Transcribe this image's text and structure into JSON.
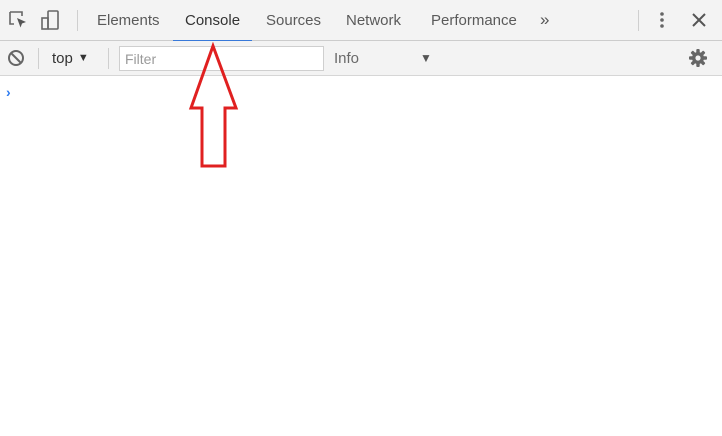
{
  "tabs": [
    {
      "label": "Elements"
    },
    {
      "label": "Console",
      "active": true
    },
    {
      "label": "Sources"
    },
    {
      "label": "Network"
    },
    {
      "label": "Performance"
    }
  ],
  "more_tabs_glyph": "»",
  "icons": {
    "inspect": "inspect-element-icon",
    "device": "device-toolbar-icon",
    "menu": "more-options-icon",
    "close": "close-icon",
    "clear": "clear-console-icon",
    "settings": "gear-icon",
    "prompt": "chevron-right-icon"
  },
  "toolbar": {
    "context": "top",
    "filter_placeholder": "Filter",
    "level": "Info"
  },
  "console": {
    "prompt": "›"
  },
  "colors": {
    "accent": "#3879d9",
    "annotation_arrow": "#e02020",
    "prompt": "#2f7cf0"
  }
}
